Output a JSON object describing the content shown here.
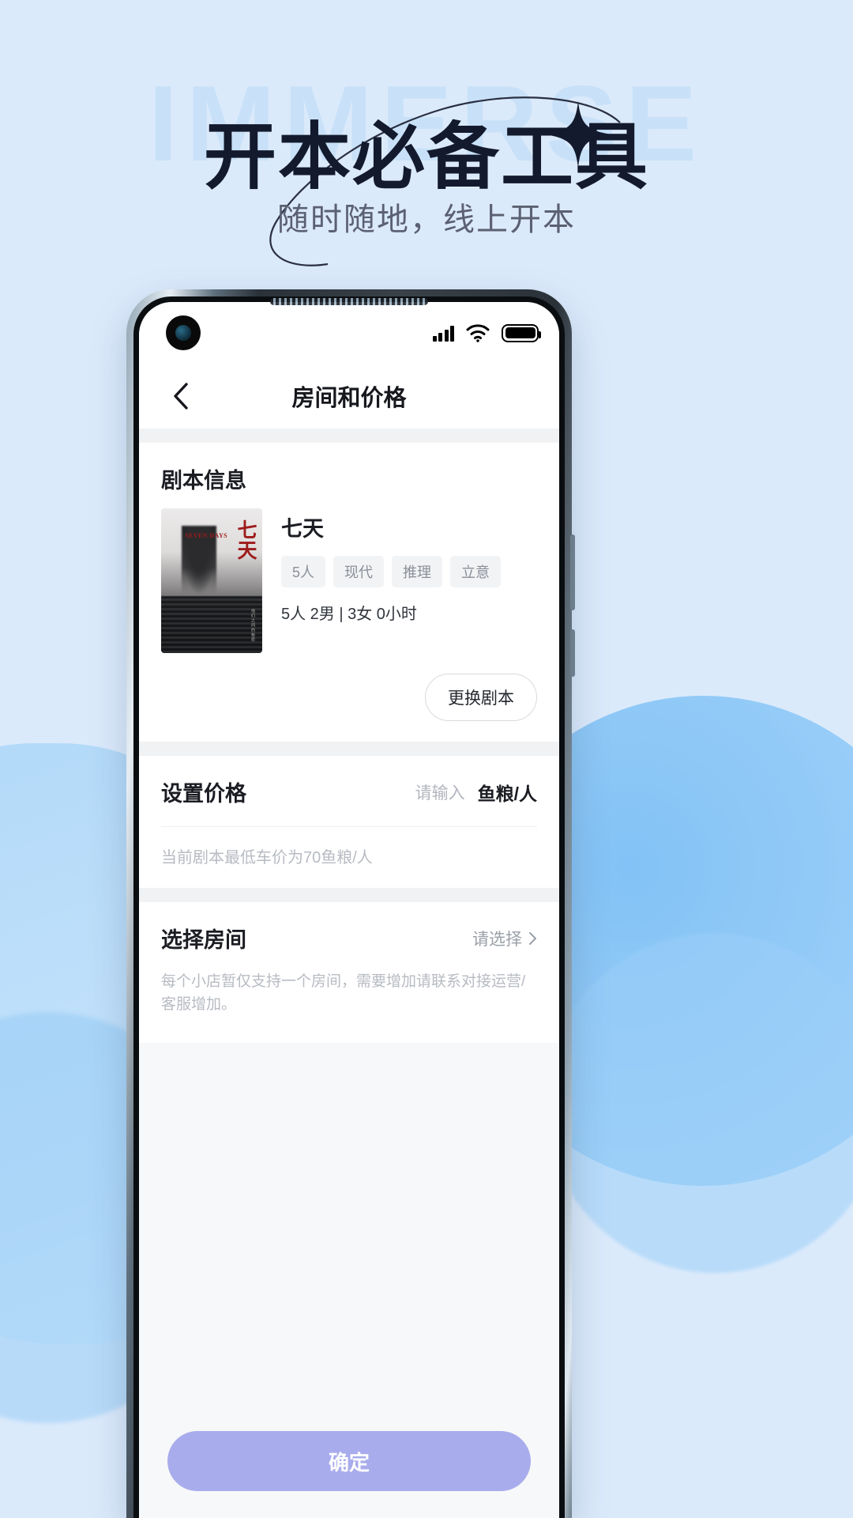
{
  "promo": {
    "ghost_word": "IMMERSE",
    "headline": "开本必备工具",
    "subtitle": "随时随地，线上开本"
  },
  "phone": {
    "statusbar": {
      "signal_icon": "signal-bars-icon",
      "wifi_icon": "wifi-icon",
      "battery_icon": "battery-icon"
    },
    "nav": {
      "back_icon": "chevron-left-icon",
      "title": "房间和价格"
    },
    "script_section": {
      "title": "剧本信息",
      "poster": {
        "cn_title": "七天",
        "en_title": "SEVEN DAYS",
        "side_note": "他们之间的秘密"
      },
      "name": "七天",
      "tags": [
        "5人",
        "现代",
        "推理",
        "立意"
      ],
      "meta": "5人 2男 | 3女 0小时",
      "change_button": "更换剧本"
    },
    "price_section": {
      "label": "设置价格",
      "input_placeholder": "请输入",
      "unit": "鱼粮/人",
      "hint": "当前剧本最低车价为70鱼粮/人"
    },
    "room_section": {
      "label": "选择房间",
      "select_placeholder": "请选择",
      "arrow_icon": "chevron-right-icon",
      "note": "每个小店暂仅支持一个房间，需要增加请联系对接运营/客服增加。"
    },
    "footer": {
      "confirm_button": "确定",
      "confirm_color": "#a9acec"
    }
  }
}
